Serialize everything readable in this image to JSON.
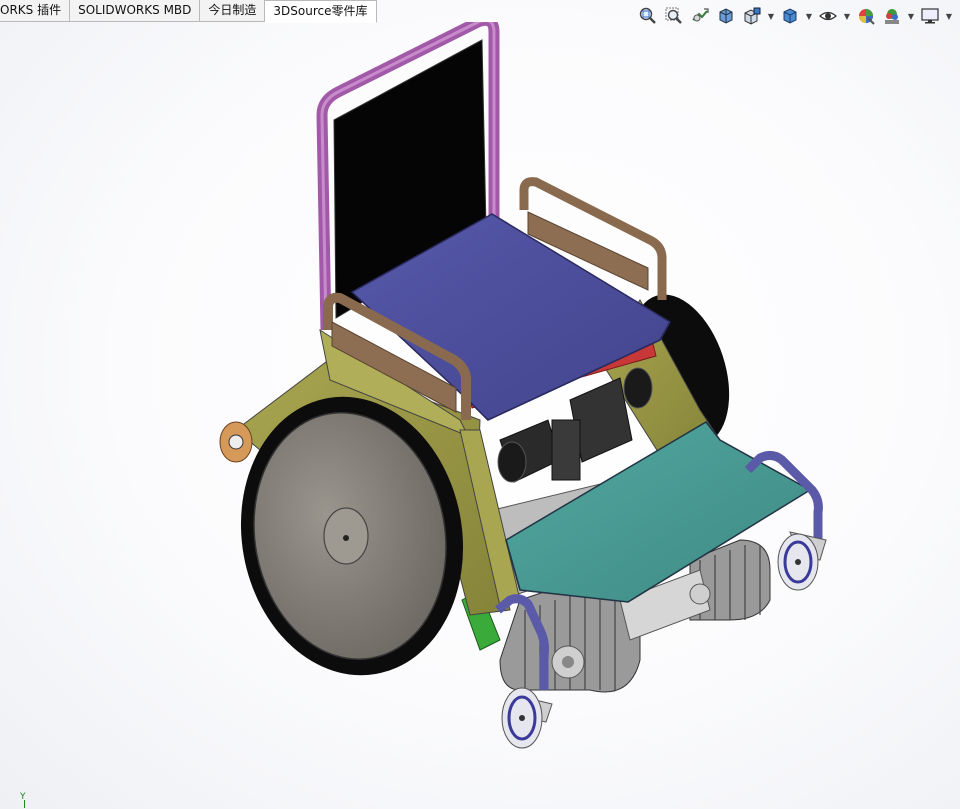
{
  "tabs": [
    {
      "label": "ORKS 插件",
      "active": false
    },
    {
      "label": "SOLIDWORKS MBD",
      "active": false
    },
    {
      "label": "今日制造",
      "active": false
    },
    {
      "label": "3DSource零件库",
      "active": true
    }
  ],
  "toolbar": {
    "icons": [
      "zoom-to-fit-icon",
      "zoom-area-icon",
      "previous-view-icon",
      "section-view-icon",
      "view-orientation-icon",
      "display-style-icon",
      "hide-show-items-icon",
      "edit-appearance-icon",
      "apply-scene-icon",
      "view-settings-icon"
    ]
  },
  "triad": {
    "axis_label": "Y"
  },
  "colors": {
    "seat": "#4a4c9c",
    "backrest": "#050505",
    "back_frame": "#a25aa8",
    "armrest": "#8a6a4e",
    "side_frame": "#9a9848",
    "footrest": "#4a9a94",
    "front_frame": "#5a5aa8",
    "wheel_tire": "#0c0c0c",
    "wheel_disc": "#8a8680",
    "track": "#7a7a7a",
    "motor": "#2a2a2a",
    "accent_red": "#c83838",
    "accent_green": "#3aaa3a"
  }
}
